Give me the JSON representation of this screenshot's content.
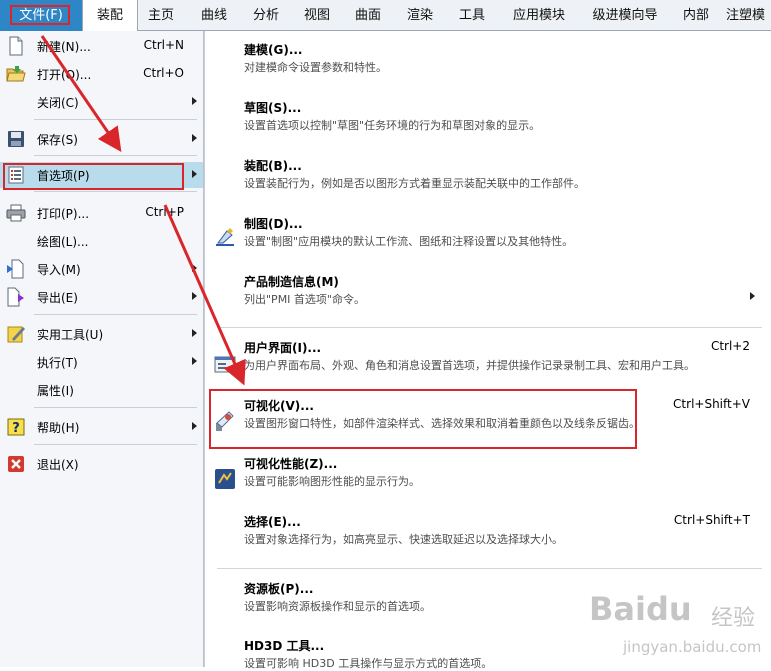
{
  "menubar": {
    "tabs": [
      {
        "label": "文件(F)",
        "x": 0
      },
      {
        "label": "装配"
      },
      {
        "label": "主页"
      },
      {
        "label": "曲线"
      },
      {
        "label": "分析"
      },
      {
        "label": "视图"
      },
      {
        "label": "曲面"
      },
      {
        "label": "渲染"
      },
      {
        "label": "工具"
      },
      {
        "label": "应用模块"
      },
      {
        "label": "级进模向导"
      },
      {
        "label": "内部"
      },
      {
        "label": "注塑模"
      }
    ]
  },
  "file_menu": {
    "items": [
      {
        "label": "新建(N)...",
        "shortcut": "Ctrl+N",
        "icon": "new-document-icon"
      },
      {
        "label": "打开(O)...",
        "shortcut": "Ctrl+O",
        "icon": "open-folder-icon"
      },
      {
        "label": "关闭(C)",
        "shortcut": "",
        "icon": ""
      },
      {
        "label": "保存(S)",
        "shortcut": "",
        "icon": "save-disk-icon"
      },
      {
        "label": "首选项(P)",
        "shortcut": "",
        "icon": "preferences-list-icon"
      },
      {
        "label": "打印(P)...",
        "shortcut": "Ctrl+P",
        "icon": "printer-icon"
      },
      {
        "label": "绘图(L)...",
        "shortcut": "",
        "icon": ""
      },
      {
        "label": "导入(M)",
        "shortcut": "",
        "icon": "import-icon"
      },
      {
        "label": "导出(E)",
        "shortcut": "",
        "icon": "export-icon"
      },
      {
        "label": "实用工具(U)",
        "shortcut": "",
        "icon": "utilities-icon"
      },
      {
        "label": "执行(T)",
        "shortcut": "",
        "icon": ""
      },
      {
        "label": "属性(I)",
        "shortcut": "",
        "icon": ""
      },
      {
        "label": "帮助(H)",
        "shortcut": "",
        "icon": "help-icon"
      },
      {
        "label": "退出(X)",
        "shortcut": "",
        "icon": "exit-icon"
      }
    ]
  },
  "preferences_menu": {
    "items": [
      {
        "title": "建模(G)...",
        "desc": "对建模命令设置参数和特性。",
        "shortcut": ""
      },
      {
        "title": "草图(S)...",
        "desc": "设置首选项以控制\"草图\"任务环境的行为和草图对象的显示。",
        "shortcut": ""
      },
      {
        "title": "装配(B)...",
        "desc": "设置装配行为，例如是否以图形方式着重显示装配关联中的工作部件。",
        "shortcut": ""
      },
      {
        "title": "制图(D)...",
        "desc": "设置\"制图\"应用模块的默认工作流、图纸和注释设置以及其他特性。",
        "shortcut": ""
      },
      {
        "title": "产品制造信息(M)",
        "desc": "列出\"PMI 首选项\"命令。",
        "shortcut": ""
      },
      {
        "title": "用户界面(I)...",
        "desc": "为用户界面布局、外观、角色和消息设置首选项，并提供操作记录录制工具、宏和用户工具。",
        "shortcut": "Ctrl+2"
      },
      {
        "title": "可视化(V)...",
        "desc": "设置图形窗口特性，如部件渲染样式、选择效果和取消着重颜色以及线条反锯齿。",
        "shortcut": "Ctrl+Shift+V"
      },
      {
        "title": "可视化性能(Z)...",
        "desc": "设置可能影响图形性能的显示行为。",
        "shortcut": ""
      },
      {
        "title": "选择(E)...",
        "desc": "设置对象选择行为，如高亮显示、快速选取延迟以及选择球大小。",
        "shortcut": "Ctrl+Shift+T"
      },
      {
        "title": "资源板(P)...",
        "desc": "设置影响资源板操作和显示的首选项。",
        "shortcut": ""
      },
      {
        "title": "HD3D 工具...",
        "desc": "设置可影响 HD3D 工具操作与显示方式的首选项。",
        "shortcut": ""
      }
    ]
  },
  "watermark": {
    "brand": "Baidu",
    "zh": "经验",
    "url": "jingyan.baidu.com"
  },
  "colors": {
    "accent": "#2f86c7",
    "highlight_box": "#d9262b",
    "selected_row": "#b9dcec"
  }
}
